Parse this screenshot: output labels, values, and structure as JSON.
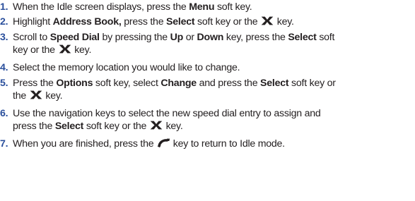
{
  "steps": [
    {
      "number": "1.",
      "t1": "When the Idle screen displays, press the ",
      "b1": "Menu",
      "t2": " soft key."
    },
    {
      "number": "2.",
      "t1": "Highlight ",
      "b1": "Address Book,",
      "t2": " press the ",
      "b2": "Select",
      "t3": " soft key or the ",
      "t4": " key."
    },
    {
      "number": "3.",
      "t1": "Scroll to ",
      "b1": "Speed Dial",
      "t2": " by pressing the ",
      "b2": "Up",
      "t3": " or ",
      "b3": "Down",
      "t4": " key, press the ",
      "b4": "Select",
      "t5": " soft",
      "t6": "key or the ",
      "t7": " key."
    },
    {
      "number": "4.",
      "t1": "Select the memory location you would like to change."
    },
    {
      "number": "5.",
      "t1": "Press the ",
      "b1": "Options",
      "t2": " soft key, select ",
      "b2": "Change",
      "t3": " and press the ",
      "b3": "Select",
      "t4": " soft key or",
      "t5": "the ",
      "t6": " key."
    },
    {
      "number": "6.",
      "t1": "Use the navigation keys to select the new speed dial entry to assign and",
      "t2": "press the ",
      "b1": "Select",
      "t3": " soft key or the ",
      "t4": " key."
    },
    {
      "number": "7.",
      "t1": "When you are finished, press the ",
      "t2": " key to return to Idle mode."
    }
  ],
  "icons": {
    "select_key": "navigation-select-key-icon",
    "end_key": "end-key-icon"
  },
  "colors": {
    "step_number": "#2a4f9c",
    "text": "#231f20"
  }
}
